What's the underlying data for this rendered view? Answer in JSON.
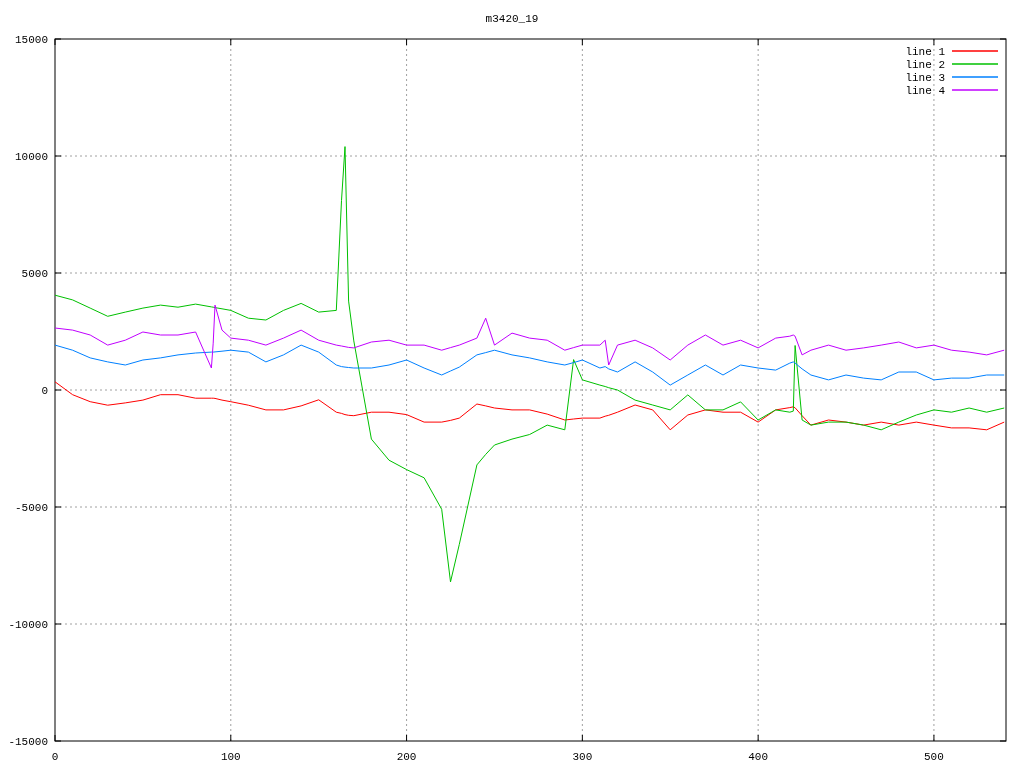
{
  "chart": {
    "chart_data": {
      "type": "line",
      "title": "m3420_19",
      "x": [
        0,
        10,
        20,
        30,
        40,
        50,
        60,
        70,
        80,
        89,
        90,
        91,
        95,
        100,
        110,
        120,
        130,
        140,
        150,
        160,
        163,
        165,
        167,
        170,
        180,
        190,
        200,
        210,
        220,
        225,
        230,
        240,
        245,
        250,
        260,
        270,
        280,
        290,
        295,
        300,
        310,
        313,
        315,
        320,
        330,
        340,
        350,
        360,
        370,
        380,
        390,
        400,
        410,
        418,
        420,
        421,
        425,
        430,
        440,
        450,
        460,
        470,
        480,
        490,
        500,
        510,
        520,
        530,
        540
      ],
      "grid": true,
      "legend": true,
      "xlim": [
        0,
        541
      ],
      "ylim": [
        -15000,
        15000
      ],
      "xticks": [
        0,
        100,
        200,
        300,
        400,
        500
      ],
      "yticks": [
        -15000,
        -10000,
        -5000,
        0,
        5000,
        10000,
        15000
      ],
      "series": [
        {
          "name": "line 1",
          "color": "#ff0000",
          "values": [
            350,
            -200,
            -500,
            -650,
            -550,
            -430,
            -200,
            -200,
            -350,
            -350,
            -350,
            -360,
            -430,
            -500,
            -650,
            -850,
            -850,
            -680,
            -420,
            -950,
            -1000,
            -1050,
            -1080,
            -1100,
            -950,
            -950,
            -1050,
            -1370,
            -1370,
            -1300,
            -1200,
            -600,
            -680,
            -770,
            -850,
            -850,
            -1030,
            -1280,
            -1240,
            -1200,
            -1200,
            -1120,
            -1080,
            -950,
            -640,
            -850,
            -1700,
            -1070,
            -850,
            -950,
            -950,
            -1370,
            -850,
            -750,
            -720,
            -760,
            -1100,
            -1500,
            -1280,
            -1370,
            -1500,
            -1370,
            -1500,
            -1370,
            -1500,
            -1620,
            -1620,
            -1700,
            -1370
          ]
        },
        {
          "name": "line 2",
          "color": "#00c000",
          "values": [
            4050,
            3850,
            3500,
            3150,
            3330,
            3500,
            3630,
            3540,
            3670,
            3550,
            3540,
            3520,
            3470,
            3400,
            3070,
            2990,
            3400,
            3700,
            3330,
            3400,
            8100,
            10400,
            3800,
            2100,
            -2100,
            -3000,
            -3400,
            -3750,
            -5100,
            -8200,
            -6600,
            -3200,
            -2750,
            -2350,
            -2100,
            -1900,
            -1500,
            -1700,
            1300,
            430,
            210,
            150,
            100,
            0,
            -430,
            -640,
            -850,
            -210,
            -850,
            -850,
            -510,
            -1280,
            -850,
            -950,
            -900,
            1900,
            -1280,
            -1500,
            -1370,
            -1370,
            -1500,
            -1700,
            -1370,
            -1070,
            -850,
            -950,
            -770,
            -950,
            -770
          ]
        },
        {
          "name": "line 3",
          "color": "#0080ff",
          "values": [
            1920,
            1700,
            1370,
            1200,
            1070,
            1280,
            1370,
            1500,
            1580,
            1620,
            1620,
            1630,
            1660,
            1700,
            1620,
            1200,
            1500,
            1920,
            1620,
            1070,
            1000,
            980,
            960,
            940,
            940,
            1070,
            1280,
            940,
            640,
            810,
            980,
            1500,
            1600,
            1700,
            1500,
            1370,
            1200,
            1070,
            1170,
            1280,
            940,
            1000,
            900,
            770,
            1200,
            770,
            210,
            640,
            1070,
            640,
            1070,
            940,
            850,
            1150,
            1200,
            1150,
            900,
            640,
            430,
            640,
            510,
            430,
            770,
            770,
            430,
            510,
            510,
            640,
            640
          ]
        },
        {
          "name": "line 4",
          "color": "#c000ff",
          "values": [
            2650,
            2560,
            2350,
            1920,
            2130,
            2480,
            2350,
            2350,
            2480,
            940,
            2000,
            3630,
            2560,
            2220,
            2130,
            1920,
            2220,
            2560,
            2130,
            1920,
            1880,
            1850,
            1820,
            1800,
            2050,
            2130,
            1920,
            1920,
            1700,
            1810,
            1920,
            2220,
            3070,
            1920,
            2430,
            2220,
            2130,
            1700,
            1810,
            1920,
            1920,
            2130,
            1070,
            1920,
            2130,
            1800,
            1280,
            1920,
            2350,
            1920,
            2130,
            1800,
            2220,
            2300,
            2350,
            2300,
            1500,
            1700,
            1920,
            1700,
            1800,
            1920,
            2050,
            1800,
            1920,
            1700,
            1620,
            1500,
            1700
          ]
        }
      ]
    }
  }
}
